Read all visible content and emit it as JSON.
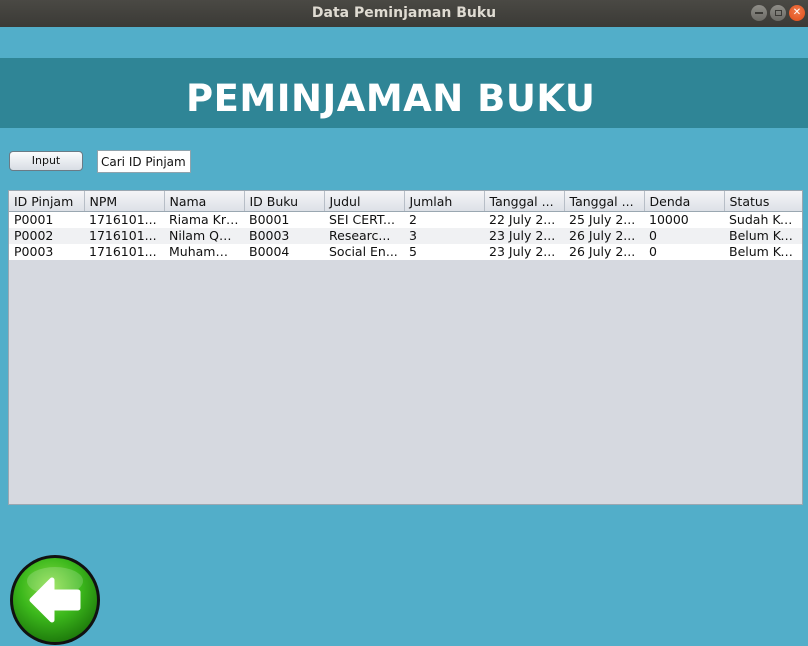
{
  "window": {
    "title": "Data Peminjaman Buku"
  },
  "header": {
    "title": "PEMINJAMAN BUKU"
  },
  "controls": {
    "input_label": "Input",
    "search_value": "Cari ID Pinjam"
  },
  "table": {
    "columns": [
      "ID Pinjam",
      "NPM",
      "Nama",
      "ID Buku",
      "Judul",
      "Jumlah",
      "Tanggal ...",
      "Tanggal ...",
      "Denda",
      "Status"
    ],
    "rows": [
      [
        "P0001",
        "1716101...",
        "Riama Kri...",
        "B0001",
        " SEI CERT...",
        "2",
        "22 July 2...",
        "25 July 2...",
        "10000",
        "Sudah Ke..."
      ],
      [
        "P0002",
        "1716101...",
        "Nilam Qolbi",
        "B0003",
        "Researc...",
        "3",
        "23 July 2...",
        "26 July 2...",
        "0",
        "Belum Ke..."
      ],
      [
        "P0003",
        "1716101...",
        "Muhamm...",
        "B0004",
        "Social En...",
        "5",
        "23 July 2...",
        "26 July 2...",
        "0",
        "Belum Ke..."
      ]
    ]
  },
  "icons": {
    "back": "back-arrow-icon",
    "minimize": "minimize-icon",
    "maximize": "maximize-icon",
    "close": "close-icon"
  },
  "colors": {
    "background": "#52aec9",
    "banner": "#2f8596",
    "back_button_green": "#3cb81c"
  }
}
